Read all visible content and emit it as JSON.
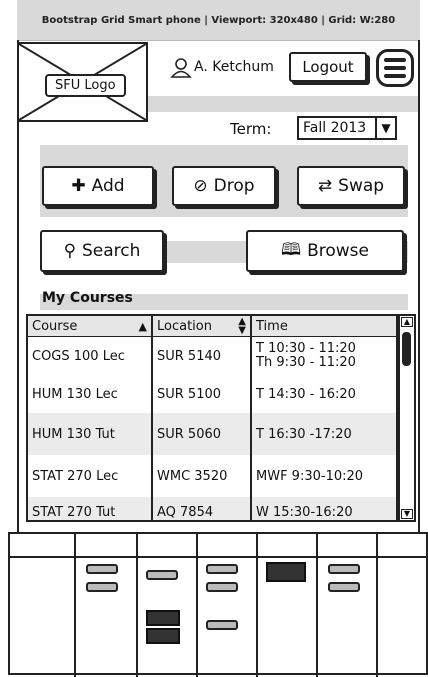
{
  "topbar": {
    "title": "Bootstrap Grid Smart phone  |  Viewport: 320x480  |  Grid: W:280"
  },
  "header": {
    "logo_label": "SFU Logo",
    "user_name": "A. Ketchum",
    "logout_label": "Logout"
  },
  "term": {
    "label": "Term:",
    "value": "Fall 2013"
  },
  "actions": {
    "add": "Add",
    "drop": "Drop",
    "swap": "Swap",
    "search": "Search",
    "browse": "Browse"
  },
  "courses": {
    "title": "My Courses",
    "columns": [
      "Course",
      "Location",
      "Time"
    ],
    "rows": [
      {
        "course": "COGS 100 Lec",
        "location": "SUR 5140",
        "time1": "T 10:30 - 11:20",
        "time2": "Th 9:30 - 11:20"
      },
      {
        "course": "HUM 130 Lec",
        "location": "SUR 5100",
        "time1": "T 14:30 - 16:20",
        "time2": ""
      },
      {
        "course": "HUM 130 Tut",
        "location": "SUR 5060",
        "time1": "T 16:30 -17:20",
        "time2": ""
      },
      {
        "course": "STAT 270 Lec",
        "location": "WMC 3520",
        "time1": "MWF 9:30-10:20",
        "time2": ""
      },
      {
        "course": "STAT 270 Tut",
        "location": "AQ 7854",
        "time1": "W 15:30-16:20",
        "time2": ""
      }
    ]
  },
  "colors": {
    "strip": "#d9d9d9",
    "ink": "#222222"
  }
}
